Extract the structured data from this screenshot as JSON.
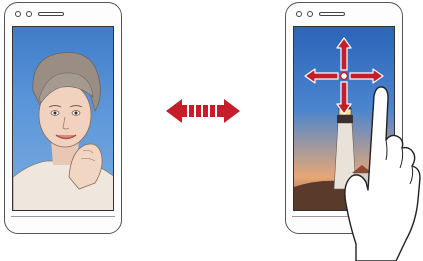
{
  "scene": {
    "left_phone": {
      "role": "front camera selfie preview",
      "screen_content": "portrait-illustration"
    },
    "right_phone": {
      "role": "rear camera preview with gesture",
      "screen_content": "lighthouse-landscape"
    },
    "gesture": "swipe-any-direction",
    "switch_arrow_icon": "double-arrow-icon"
  },
  "colors": {
    "arrow_red": "#c41e2a",
    "phone_outline": "#555555",
    "sky_blue": "#3f7cc9"
  }
}
